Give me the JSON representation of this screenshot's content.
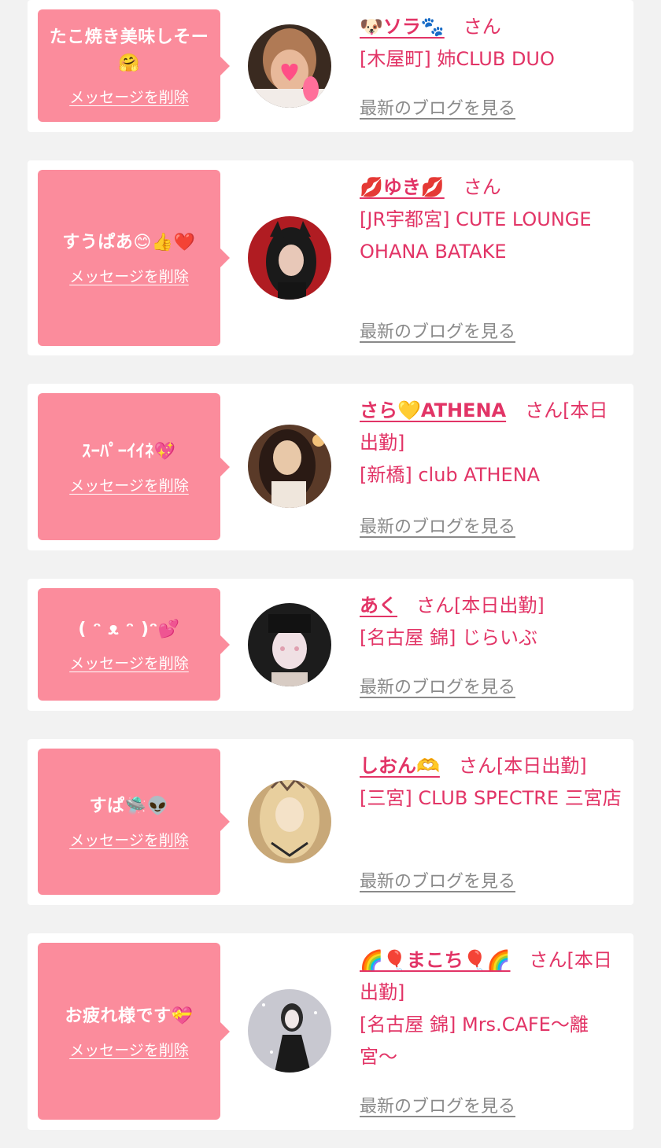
{
  "ui": {
    "delete_label": "メッセージを削除",
    "blog_label": "最新のブログを見る",
    "san_suffix": "さん"
  },
  "colors": {
    "page_bg": "#f2f2f2",
    "bubble_bg": "#fb8c9c",
    "accent_pink": "#e23466",
    "blog_gray": "#8a8a8a"
  },
  "items": [
    {
      "message": "たこ焼き美味しそー🤗",
      "name": "🐶ソラ🐾",
      "status": "",
      "shop": "[木屋町] 姉CLUB DUO",
      "avatar_colors": [
        "#3a2a20",
        "#c98a6a",
        "#ff6f9a"
      ]
    },
    {
      "message": "すうぱあ😊👍❤️",
      "name": "💋ゆき💋",
      "status": "",
      "shop": "[JR宇都宮] CUTE LOUNGE OHANA BATAKE",
      "avatar_colors": [
        "#b01c22",
        "#1a1a1a",
        "#e8c8b8"
      ]
    },
    {
      "message": "ｽｰﾊﾟｰｲｲﾈ💖",
      "name": "さら💛ATHENA",
      "status": "[本日出勤]",
      "shop": "[新橋] club ATHENA",
      "avatar_colors": [
        "#5a3a28",
        "#2a1a14",
        "#e8c8a8"
      ]
    },
    {
      "message": "( ᵔ ᴥ ᵔ )ᵔ💕",
      "name": "あく",
      "status": "[本日出勤]",
      "shop": "[名古屋 錦] じらいぶ",
      "avatar_colors": [
        "#1c1c1c",
        "#f0e0e4",
        "#e0a0b0"
      ]
    },
    {
      "message": "すぱ🛸👽",
      "name": "しおん🫶",
      "status": "[本日出勤]",
      "shop": "[三宮] CLUB SPECTRE 三宮店",
      "avatar_colors": [
        "#d8b888",
        "#f4e2c8",
        "#6a5040"
      ]
    },
    {
      "message": "お疲れ様です💝",
      "name": "🌈🎈まこち🎈🌈",
      "status": "[本日出勤]",
      "shop": "[名古屋 錦] Mrs.CAFE〜離宮〜",
      "avatar_colors": [
        "#c8c8d0",
        "#2a2a2a",
        "#f0e8e8"
      ]
    }
  ]
}
